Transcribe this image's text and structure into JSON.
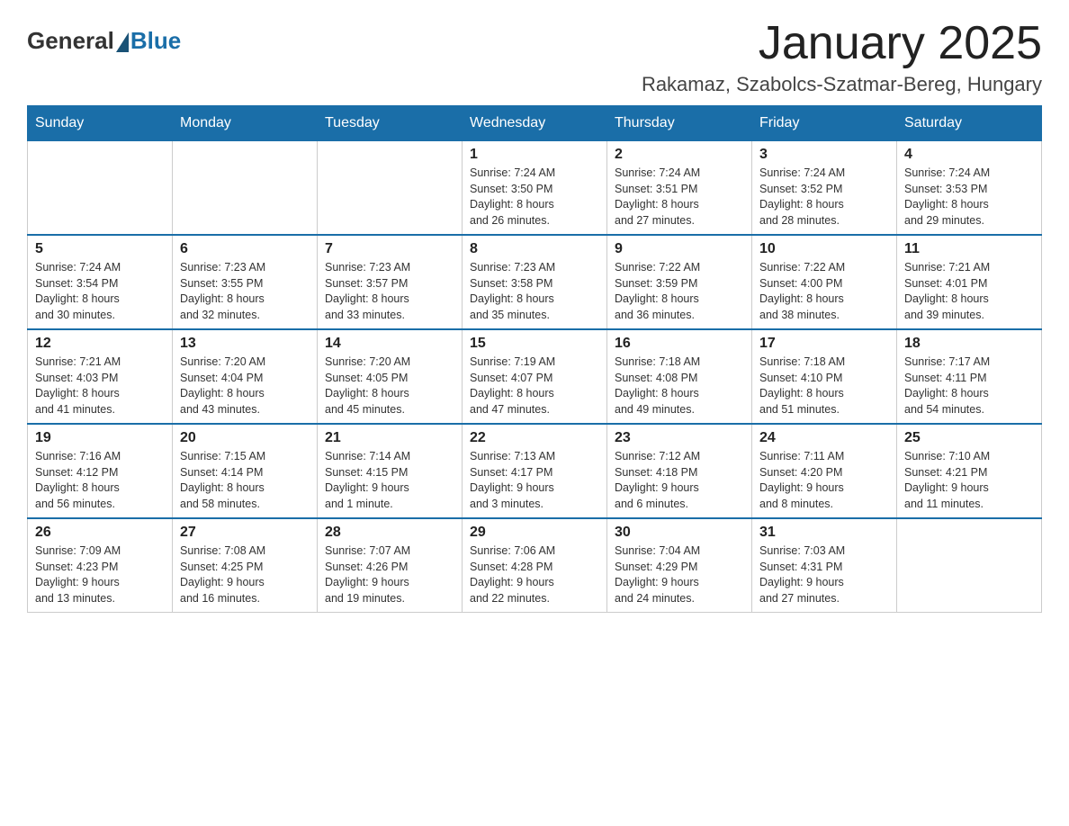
{
  "logo": {
    "text_general": "General",
    "text_blue": "Blue"
  },
  "title": "January 2025",
  "subtitle": "Rakamaz, Szabolcs-Szatmar-Bereg, Hungary",
  "days_of_week": [
    "Sunday",
    "Monday",
    "Tuesday",
    "Wednesday",
    "Thursday",
    "Friday",
    "Saturday"
  ],
  "weeks": [
    [
      {
        "day": "",
        "info": ""
      },
      {
        "day": "",
        "info": ""
      },
      {
        "day": "",
        "info": ""
      },
      {
        "day": "1",
        "info": "Sunrise: 7:24 AM\nSunset: 3:50 PM\nDaylight: 8 hours\nand 26 minutes."
      },
      {
        "day": "2",
        "info": "Sunrise: 7:24 AM\nSunset: 3:51 PM\nDaylight: 8 hours\nand 27 minutes."
      },
      {
        "day": "3",
        "info": "Sunrise: 7:24 AM\nSunset: 3:52 PM\nDaylight: 8 hours\nand 28 minutes."
      },
      {
        "day": "4",
        "info": "Sunrise: 7:24 AM\nSunset: 3:53 PM\nDaylight: 8 hours\nand 29 minutes."
      }
    ],
    [
      {
        "day": "5",
        "info": "Sunrise: 7:24 AM\nSunset: 3:54 PM\nDaylight: 8 hours\nand 30 minutes."
      },
      {
        "day": "6",
        "info": "Sunrise: 7:23 AM\nSunset: 3:55 PM\nDaylight: 8 hours\nand 32 minutes."
      },
      {
        "day": "7",
        "info": "Sunrise: 7:23 AM\nSunset: 3:57 PM\nDaylight: 8 hours\nand 33 minutes."
      },
      {
        "day": "8",
        "info": "Sunrise: 7:23 AM\nSunset: 3:58 PM\nDaylight: 8 hours\nand 35 minutes."
      },
      {
        "day": "9",
        "info": "Sunrise: 7:22 AM\nSunset: 3:59 PM\nDaylight: 8 hours\nand 36 minutes."
      },
      {
        "day": "10",
        "info": "Sunrise: 7:22 AM\nSunset: 4:00 PM\nDaylight: 8 hours\nand 38 minutes."
      },
      {
        "day": "11",
        "info": "Sunrise: 7:21 AM\nSunset: 4:01 PM\nDaylight: 8 hours\nand 39 minutes."
      }
    ],
    [
      {
        "day": "12",
        "info": "Sunrise: 7:21 AM\nSunset: 4:03 PM\nDaylight: 8 hours\nand 41 minutes."
      },
      {
        "day": "13",
        "info": "Sunrise: 7:20 AM\nSunset: 4:04 PM\nDaylight: 8 hours\nand 43 minutes."
      },
      {
        "day": "14",
        "info": "Sunrise: 7:20 AM\nSunset: 4:05 PM\nDaylight: 8 hours\nand 45 minutes."
      },
      {
        "day": "15",
        "info": "Sunrise: 7:19 AM\nSunset: 4:07 PM\nDaylight: 8 hours\nand 47 minutes."
      },
      {
        "day": "16",
        "info": "Sunrise: 7:18 AM\nSunset: 4:08 PM\nDaylight: 8 hours\nand 49 minutes."
      },
      {
        "day": "17",
        "info": "Sunrise: 7:18 AM\nSunset: 4:10 PM\nDaylight: 8 hours\nand 51 minutes."
      },
      {
        "day": "18",
        "info": "Sunrise: 7:17 AM\nSunset: 4:11 PM\nDaylight: 8 hours\nand 54 minutes."
      }
    ],
    [
      {
        "day": "19",
        "info": "Sunrise: 7:16 AM\nSunset: 4:12 PM\nDaylight: 8 hours\nand 56 minutes."
      },
      {
        "day": "20",
        "info": "Sunrise: 7:15 AM\nSunset: 4:14 PM\nDaylight: 8 hours\nand 58 minutes."
      },
      {
        "day": "21",
        "info": "Sunrise: 7:14 AM\nSunset: 4:15 PM\nDaylight: 9 hours\nand 1 minute."
      },
      {
        "day": "22",
        "info": "Sunrise: 7:13 AM\nSunset: 4:17 PM\nDaylight: 9 hours\nand 3 minutes."
      },
      {
        "day": "23",
        "info": "Sunrise: 7:12 AM\nSunset: 4:18 PM\nDaylight: 9 hours\nand 6 minutes."
      },
      {
        "day": "24",
        "info": "Sunrise: 7:11 AM\nSunset: 4:20 PM\nDaylight: 9 hours\nand 8 minutes."
      },
      {
        "day": "25",
        "info": "Sunrise: 7:10 AM\nSunset: 4:21 PM\nDaylight: 9 hours\nand 11 minutes."
      }
    ],
    [
      {
        "day": "26",
        "info": "Sunrise: 7:09 AM\nSunset: 4:23 PM\nDaylight: 9 hours\nand 13 minutes."
      },
      {
        "day": "27",
        "info": "Sunrise: 7:08 AM\nSunset: 4:25 PM\nDaylight: 9 hours\nand 16 minutes."
      },
      {
        "day": "28",
        "info": "Sunrise: 7:07 AM\nSunset: 4:26 PM\nDaylight: 9 hours\nand 19 minutes."
      },
      {
        "day": "29",
        "info": "Sunrise: 7:06 AM\nSunset: 4:28 PM\nDaylight: 9 hours\nand 22 minutes."
      },
      {
        "day": "30",
        "info": "Sunrise: 7:04 AM\nSunset: 4:29 PM\nDaylight: 9 hours\nand 24 minutes."
      },
      {
        "day": "31",
        "info": "Sunrise: 7:03 AM\nSunset: 4:31 PM\nDaylight: 9 hours\nand 27 minutes."
      },
      {
        "day": "",
        "info": ""
      }
    ]
  ]
}
